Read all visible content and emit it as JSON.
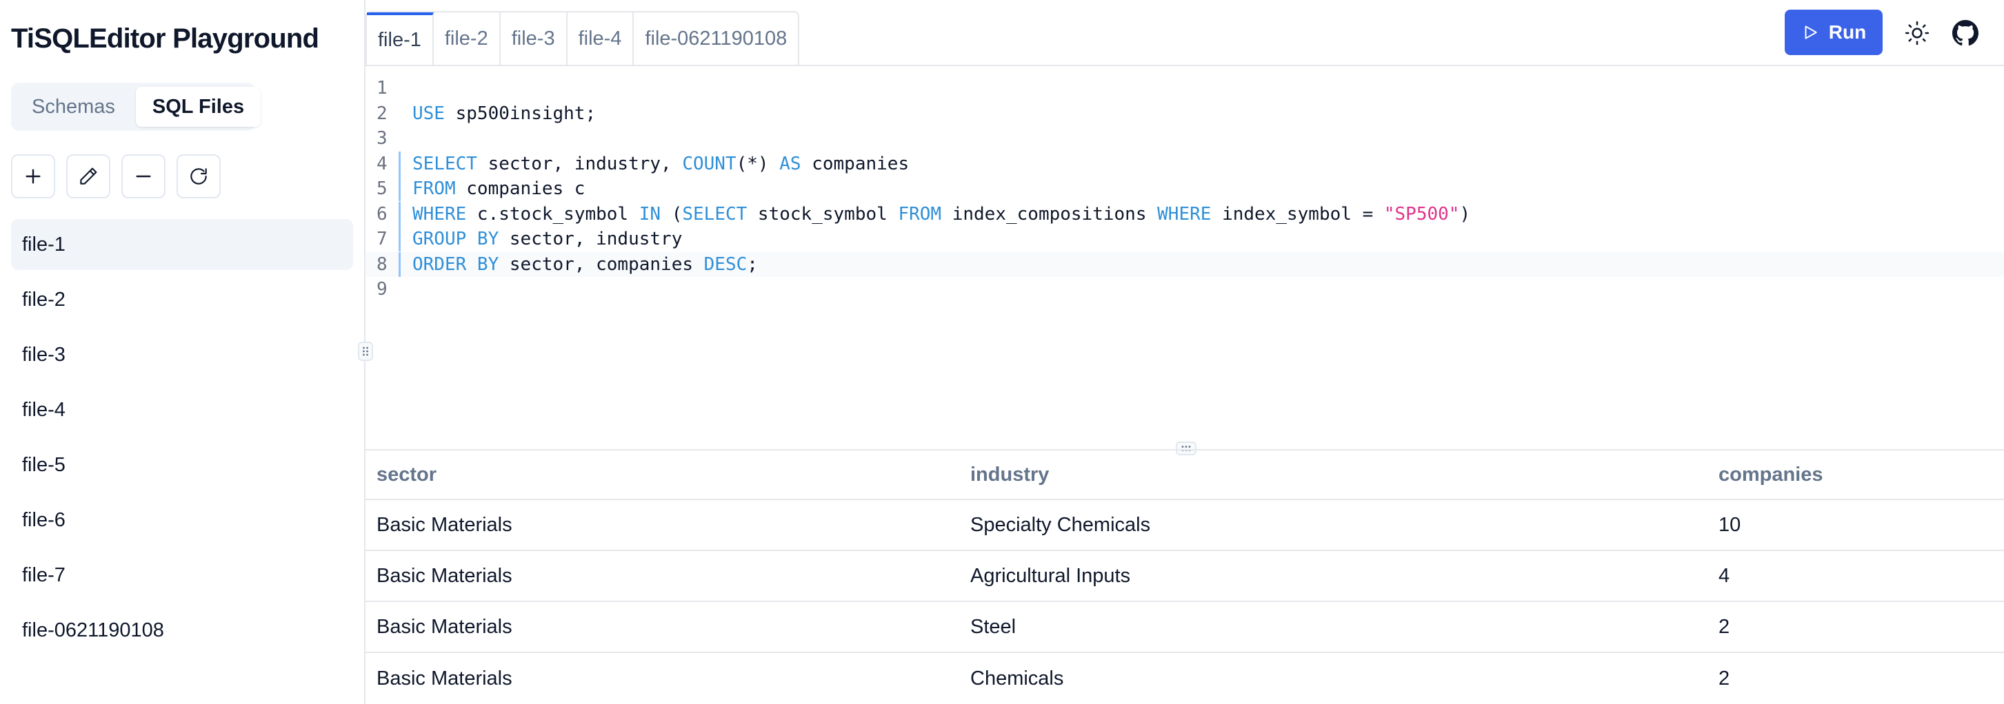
{
  "app": {
    "title": "TiSQLEditor Playground"
  },
  "sidebar": {
    "segments": [
      {
        "label": "Schemas",
        "active": false
      },
      {
        "label": "SQL Files",
        "active": true
      }
    ],
    "toolbar": [
      {
        "name": "add-file-button",
        "icon": "plus-icon"
      },
      {
        "name": "rename-file-button",
        "icon": "pencil-icon"
      },
      {
        "name": "delete-file-button",
        "icon": "minus-icon"
      },
      {
        "name": "refresh-button",
        "icon": "refresh-icon"
      }
    ],
    "files": [
      {
        "label": "file-1",
        "active": true
      },
      {
        "label": "file-2",
        "active": false
      },
      {
        "label": "file-3",
        "active": false
      },
      {
        "label": "file-4",
        "active": false
      },
      {
        "label": "file-5",
        "active": false
      },
      {
        "label": "file-6",
        "active": false
      },
      {
        "label": "file-7",
        "active": false
      },
      {
        "label": "file-0621190108",
        "active": false
      }
    ]
  },
  "tabs": [
    {
      "label": "file-1",
      "active": true
    },
    {
      "label": "file-2",
      "active": false
    },
    {
      "label": "file-3",
      "active": false
    },
    {
      "label": "file-4",
      "active": false
    },
    {
      "label": "file-0621190108",
      "active": false
    }
  ],
  "header": {
    "run_label": "Run",
    "theme_icon": "sun-icon",
    "github_icon": "github-icon"
  },
  "editor": {
    "current_line": 8,
    "selected_lines": [
      4,
      5,
      6,
      7,
      8
    ],
    "lines": [
      {
        "num": "1",
        "tokens": []
      },
      {
        "num": "2",
        "tokens": [
          {
            "t": "USE",
            "c": "kw"
          },
          {
            "t": " sp500insight;",
            "c": ""
          }
        ]
      },
      {
        "num": "3",
        "tokens": []
      },
      {
        "num": "4",
        "tokens": [
          {
            "t": "SELECT",
            "c": "kw"
          },
          {
            "t": " sector, industry, ",
            "c": ""
          },
          {
            "t": "COUNT",
            "c": "kw"
          },
          {
            "t": "(*) ",
            "c": ""
          },
          {
            "t": "AS",
            "c": "kw"
          },
          {
            "t": " companies",
            "c": ""
          }
        ]
      },
      {
        "num": "5",
        "tokens": [
          {
            "t": "FROM",
            "c": "kw"
          },
          {
            "t": " companies c",
            "c": ""
          }
        ]
      },
      {
        "num": "6",
        "tokens": [
          {
            "t": "WHERE",
            "c": "kw"
          },
          {
            "t": " c.stock_symbol ",
            "c": ""
          },
          {
            "t": "IN",
            "c": "kw"
          },
          {
            "t": " (",
            "c": ""
          },
          {
            "t": "SELECT",
            "c": "kw"
          },
          {
            "t": " stock_symbol ",
            "c": ""
          },
          {
            "t": "FROM",
            "c": "kw"
          },
          {
            "t": " index_compositions ",
            "c": ""
          },
          {
            "t": "WHERE",
            "c": "kw"
          },
          {
            "t": " index_symbol = ",
            "c": ""
          },
          {
            "t": "\"SP500\"",
            "c": "str"
          },
          {
            "t": ")",
            "c": ""
          }
        ]
      },
      {
        "num": "7",
        "tokens": [
          {
            "t": "GROUP BY",
            "c": "kw"
          },
          {
            "t": " sector, industry",
            "c": ""
          }
        ]
      },
      {
        "num": "8",
        "tokens": [
          {
            "t": "ORDER BY",
            "c": "kw"
          },
          {
            "t": " sector, companies ",
            "c": ""
          },
          {
            "t": "DESC",
            "c": "kw"
          },
          {
            "t": ";",
            "c": ""
          }
        ]
      },
      {
        "num": "9",
        "tokens": []
      }
    ]
  },
  "results": {
    "columns": [
      "sector",
      "industry",
      "companies"
    ],
    "rows": [
      [
        "Basic Materials",
        "Specialty Chemicals",
        "10"
      ],
      [
        "Basic Materials",
        "Agricultural Inputs",
        "4"
      ],
      [
        "Basic Materials",
        "Steel",
        "2"
      ],
      [
        "Basic Materials",
        "Chemicals",
        "2"
      ]
    ]
  },
  "colors": {
    "accent": "#3b63e9",
    "keyword": "#2f8fd8",
    "string": "#e0338a",
    "active_tab_border": "#2563eb"
  }
}
